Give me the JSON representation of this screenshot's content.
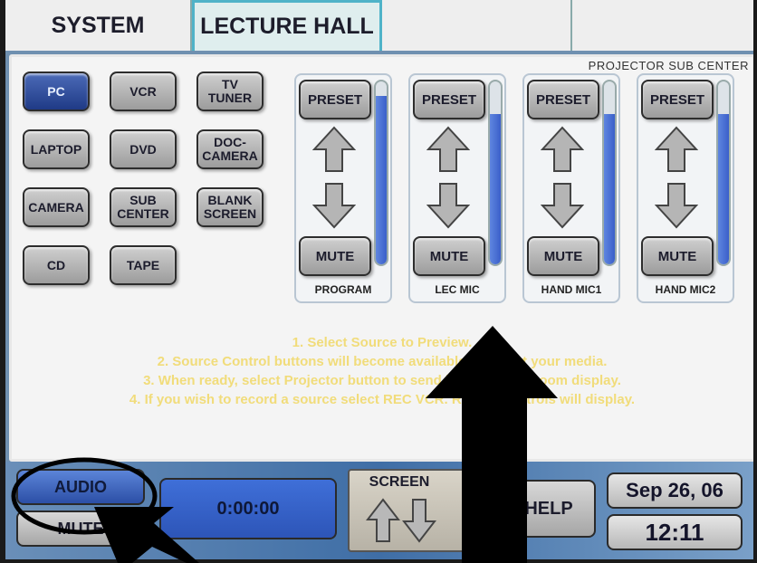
{
  "tabs": [
    {
      "label": "SYSTEM",
      "active": false
    },
    {
      "label": "LECTURE HALL",
      "active": true
    },
    {
      "label": "",
      "active": false
    },
    {
      "label": "",
      "active": false
    }
  ],
  "panel_label": "PROJECTOR SUB CENTER",
  "sources": [
    {
      "label": "PC",
      "selected": true
    },
    {
      "label": "VCR",
      "selected": false
    },
    {
      "label": "TV\nTUNER",
      "selected": false
    },
    {
      "label": "LAPTOP",
      "selected": false
    },
    {
      "label": "DVD",
      "selected": false
    },
    {
      "label": "DOC-\nCAMERA",
      "selected": false
    },
    {
      "label": "CAMERA",
      "selected": false
    },
    {
      "label": "SUB\nCENTER",
      "selected": false
    },
    {
      "label": "BLANK\nSCREEN",
      "selected": false
    },
    {
      "label": "CD",
      "selected": false
    },
    {
      "label": "TAPE",
      "selected": false
    }
  ],
  "mixer": {
    "preset_label": "PRESET",
    "mute_label": "MUTE",
    "channels": [
      {
        "name": "PROGRAM",
        "level": 0.92
      },
      {
        "name": "LEC MIC",
        "level": 0.82
      },
      {
        "name": "HAND MIC1",
        "level": 0.82
      },
      {
        "name": "HAND MIC2",
        "level": 0.82
      }
    ]
  },
  "instructions": [
    "1. Select Source to Preview.",
    "2. Source Control buttons will become available to preset your media.",
    "3. When ready, select Projector button to send it to the main room display.",
    "4. If you wish to record a source select REC VCR. Record controls will display."
  ],
  "bottom": {
    "audio_label": "AUDIO",
    "mute_label": "MUTE",
    "timer": "0:00:00",
    "screen_label": "SCREEN",
    "help_label": "HELP",
    "date": "Sep 26, 06",
    "time": "12:11"
  },
  "colors": {
    "selected_button": "#2c4fa6",
    "meter_fill": "#3a5fc9",
    "instruction_text": "#f1dc7a",
    "annotation_black": "#000000"
  }
}
